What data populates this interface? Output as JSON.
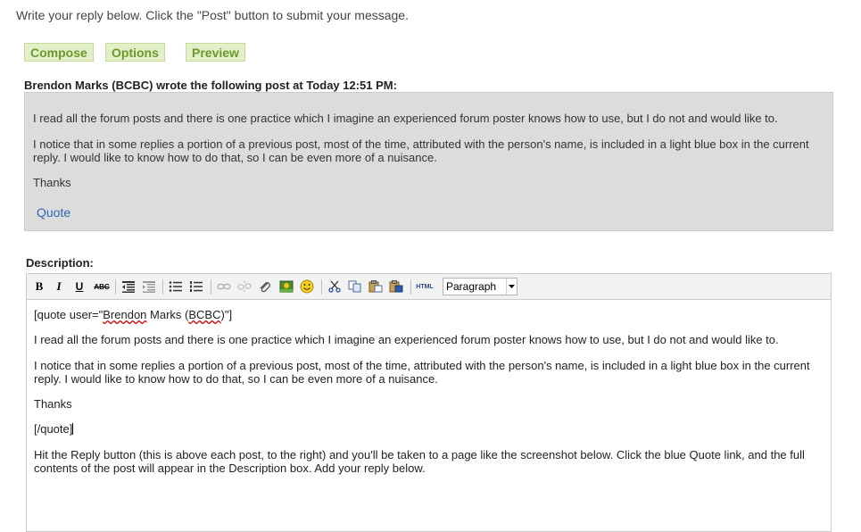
{
  "instruction": "Write your reply below. Click the \"Post\" button to submit your message.",
  "tabs": [
    {
      "label": "Compose"
    },
    {
      "label": "Options"
    },
    {
      "label": "Preview"
    }
  ],
  "quoted_post": {
    "heading": "Brendon Marks (BCBC) wrote the following post at Today 12:51 PM:",
    "paragraphs": [
      "I read all the forum posts and there is one practice which I imagine an experienced forum poster knows how to use, but I do not and would like to.",
      "I notice that in some replies a portion of a previous post, most of the time, attributed with the person's name, is included in a light blue box in the current reply. I would like to know how to do that, so I can be even more of a nuisance.",
      "Thanks"
    ],
    "quote_link": "Quote"
  },
  "description": {
    "label": "Description:",
    "toolbar": {
      "bold": "B",
      "italic": "I",
      "underline": "U",
      "strike": "ABC",
      "html": "HTML",
      "format_value": "Paragraph",
      "buttons": [
        "bold",
        "italic",
        "underline",
        "strikethrough",
        "outdent",
        "indent",
        "bullet-list",
        "numbered-list",
        "link",
        "unlink",
        "attachment",
        "insert-image",
        "emoticon",
        "cut",
        "copy",
        "paste",
        "paste-word",
        "html-source",
        "format-select"
      ]
    },
    "content": {
      "open_prefix": "[quote user=\"",
      "open_name": "Brendon",
      "open_space": " Marks (",
      "open_abbr": "BCBC",
      "open_suffix": ")\"]",
      "p1": "I read all the forum posts and there is one practice which I imagine an experienced forum poster knows how to use, but I do not and would like to.",
      "p2": "I notice that in some replies a portion of a previous post, most of the time, attributed with the person's name, is included in a light blue box in the current reply. I would like to know how to do that, so I can be even more of a nuisance.",
      "p3": "Thanks",
      "close": "[/quote]",
      "p4": "Hit the Reply button (this is above each post, to the right) and you'll be taken to a page like the screenshot below. Click the blue Quote link, and the full contents of the post will appear in the Description box.  Add your reply below."
    }
  },
  "colors": {
    "tab_bg": "#e2efc8",
    "tab_text": "#6a9a2a",
    "quote_bg": "#dcdcdc",
    "link": "#2a6bb5"
  }
}
